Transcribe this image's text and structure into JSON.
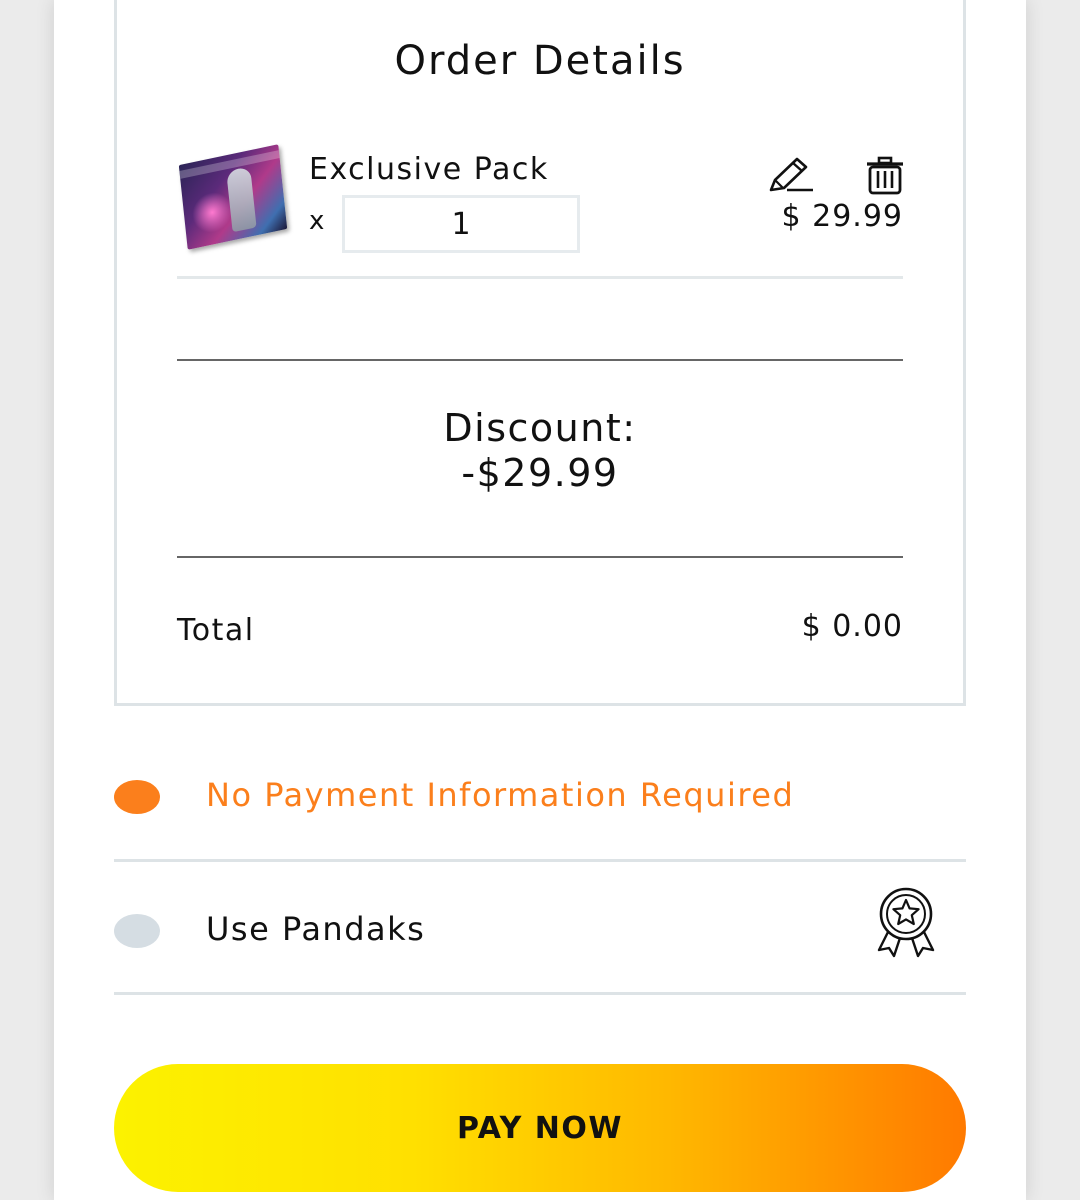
{
  "order": {
    "title": "Order Details",
    "item": {
      "name": "Exclusive Pack",
      "qty_prefix": "x",
      "quantity": "1",
      "price": "$ 29.99",
      "image_icon": "product-box-image",
      "edit_icon": "pencil-icon",
      "delete_icon": "trash-icon"
    },
    "discount": {
      "label": "Discount:",
      "value": "-$29.99"
    },
    "total": {
      "label": "Total",
      "value": "$ 0.00"
    }
  },
  "payment_options": [
    {
      "label": "No Payment Information Required",
      "selected": true,
      "color": "#fb7f1c",
      "dot_color": "#fb7f1c"
    },
    {
      "label": "Use Pandaks",
      "selected": false,
      "color": "#111111",
      "dot_color": "#d5dde3",
      "icon": "award-badge-icon"
    }
  ],
  "pay_button": {
    "label": "PAY NOW",
    "gradient": [
      "#fcf200",
      "#ff7a00"
    ]
  }
}
